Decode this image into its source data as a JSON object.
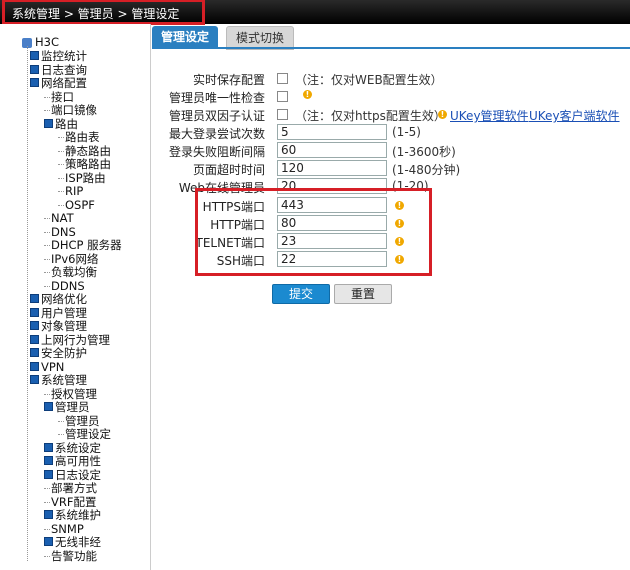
{
  "breadcrumb": "系统管理 > 管理员 > 管理设定",
  "tabs": [
    {
      "label": "管理设定",
      "active": true
    },
    {
      "label": "模式切换",
      "active": false
    }
  ],
  "sidebar": {
    "root": "H3C",
    "items": [
      {
        "label": "监控统计",
        "level": 1,
        "icon": "expand-box-icon"
      },
      {
        "label": "日志查询",
        "level": 1,
        "icon": "expand-box-icon"
      },
      {
        "label": "网络配置",
        "level": 1,
        "icon": "collapse-box-icon"
      },
      {
        "label": "接口",
        "level": 2
      },
      {
        "label": "端口镜像",
        "level": 2
      },
      {
        "label": "路由",
        "level": 2,
        "icon": "collapse-box-icon"
      },
      {
        "label": "路由表",
        "level": 3
      },
      {
        "label": "静态路由",
        "level": 3
      },
      {
        "label": "策略路由",
        "level": 3
      },
      {
        "label": "ISP路由",
        "level": 3
      },
      {
        "label": "RIP",
        "level": 3
      },
      {
        "label": "OSPF",
        "level": 3
      },
      {
        "label": "NAT",
        "level": 2
      },
      {
        "label": "DNS",
        "level": 2
      },
      {
        "label": "DHCP 服务器",
        "level": 2
      },
      {
        "label": "IPv6网络",
        "level": 2
      },
      {
        "label": "负载均衡",
        "level": 2
      },
      {
        "label": "DDNS",
        "level": 2
      },
      {
        "label": "网络优化",
        "level": 1,
        "icon": "expand-box-icon"
      },
      {
        "label": "用户管理",
        "level": 1,
        "icon": "expand-box-icon"
      },
      {
        "label": "对象管理",
        "level": 1,
        "icon": "expand-box-icon"
      },
      {
        "label": "上网行为管理",
        "level": 1,
        "icon": "expand-box-icon"
      },
      {
        "label": "安全防护",
        "level": 1,
        "icon": "expand-box-icon"
      },
      {
        "label": "VPN",
        "level": 1,
        "icon": "expand-box-icon"
      },
      {
        "label": "系统管理",
        "level": 1,
        "icon": "collapse-box-icon"
      },
      {
        "label": "授权管理",
        "level": 2
      },
      {
        "label": "管理员",
        "level": 2,
        "icon": "collapse-box-icon"
      },
      {
        "label": "管理员",
        "level": 3
      },
      {
        "label": "管理设定",
        "level": 3
      },
      {
        "label": "系统设定",
        "level": 2,
        "icon": "expand-box-icon"
      },
      {
        "label": "高可用性",
        "level": 2,
        "icon": "expand-box-icon"
      },
      {
        "label": "日志设定",
        "level": 2,
        "icon": "expand-box-icon"
      },
      {
        "label": "部署方式",
        "level": 2
      },
      {
        "label": "VRF配置",
        "level": 2
      },
      {
        "label": "系统维护",
        "level": 2,
        "icon": "expand-box-icon"
      },
      {
        "label": "SNMP",
        "level": 2
      },
      {
        "label": "无线非经",
        "level": 2,
        "icon": "expand-box-icon"
      },
      {
        "label": "告警功能",
        "level": 2
      }
    ]
  },
  "form": {
    "realtime_save": {
      "label": "实时保存配置",
      "note": "（注：仅对WEB配置生效）"
    },
    "admin_unique": {
      "label": "管理员唯一性检查"
    },
    "two_factor": {
      "label": "管理员双因子认证",
      "note": "（注：仅对https配置生效）",
      "link1": "UKey管理软件",
      "link2": "UKey客户端软件"
    },
    "max_login": {
      "label": "最大登录尝试次数",
      "value": "5",
      "hint": "(1-5)"
    },
    "login_block": {
      "label": "登录失败阻断间隔",
      "value": "60",
      "hint": "(1-3600秒)"
    },
    "page_timeout": {
      "label": "页面超时时间",
      "value": "120",
      "hint": "(1-480分钟)"
    },
    "web_online": {
      "label": "Web在线管理员",
      "value": "20",
      "hint": "(1-20)"
    },
    "https_port": {
      "label": "HTTPS端口",
      "value": "443"
    },
    "http_port": {
      "label": "HTTP端口",
      "value": "80"
    },
    "telnet_port": {
      "label": "TELNET端口",
      "value": "23"
    },
    "ssh_port": {
      "label": "SSH端口",
      "value": "22"
    }
  },
  "buttons": {
    "submit": "提交",
    "reset": "重置"
  },
  "colors": {
    "accent": "#2a7fc0",
    "highlight": "#d61f26",
    "warning": "#f0a800"
  }
}
